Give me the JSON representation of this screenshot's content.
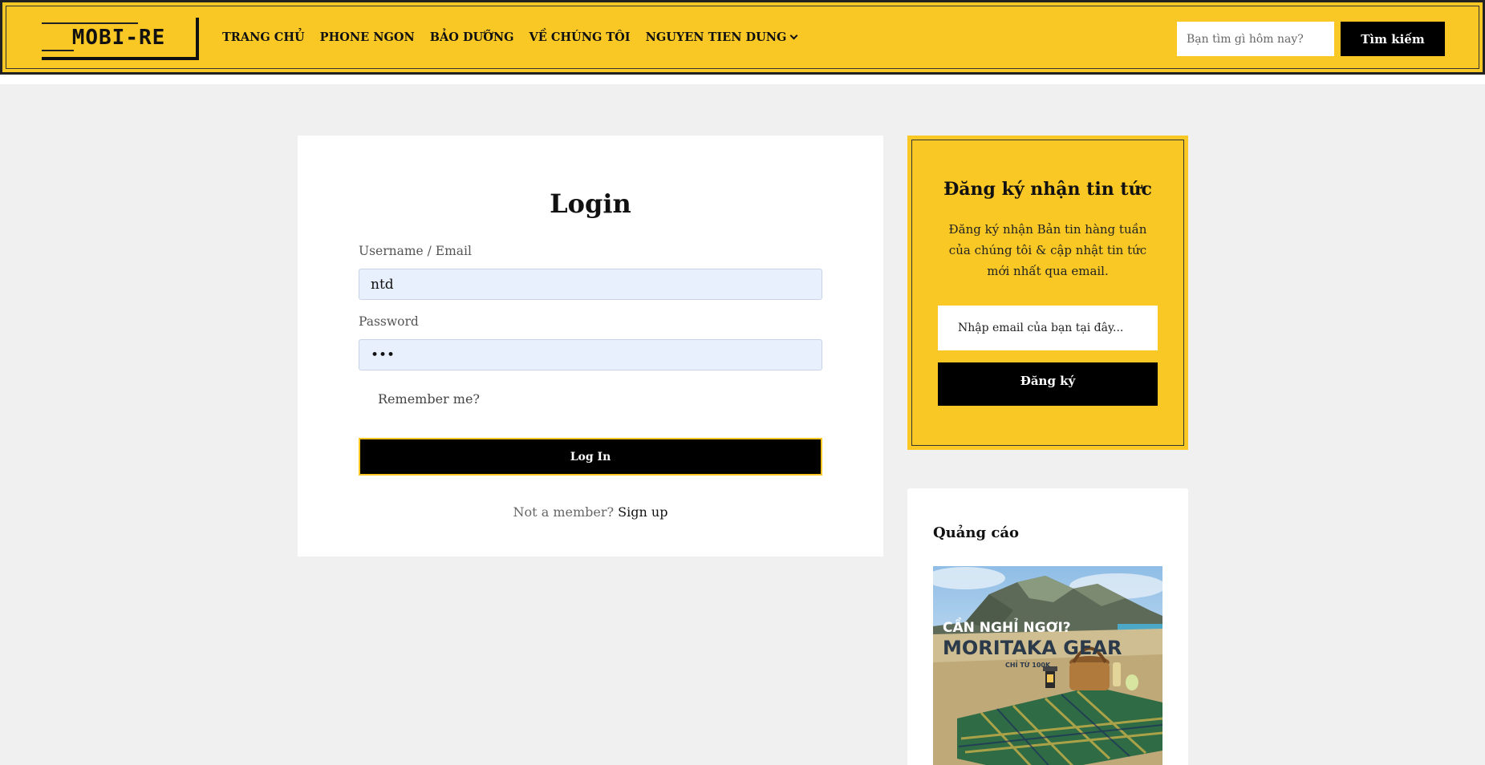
{
  "header": {
    "logo_text": "MOBI-RE",
    "nav": [
      {
        "label": "TRANG CHỦ"
      },
      {
        "label": "PHONE NGON"
      },
      {
        "label": "BẢO DƯỠNG"
      },
      {
        "label": "VỀ CHÚNG TÔI"
      },
      {
        "label": "NGUYEN TIEN DUNG",
        "has_dropdown": true
      }
    ],
    "search": {
      "placeholder": "Bạn tìm gì hôm nay?",
      "button_label": "Tìm kiếm"
    }
  },
  "login": {
    "title": "Login",
    "username_label": "Username / Email",
    "username_value": "ntd",
    "password_label": "Password",
    "password_value": "•••",
    "remember_label": "Remember me?",
    "submit_label": "Log In",
    "signup_prefix": "Not a member?",
    "signup_link": "Sign up"
  },
  "newsletter": {
    "title": "Đăng ký nhận tin tức",
    "description": "Đăng ký nhận Bản tin hàng tuần của chúng tôi & cập nhật tin tức mới nhất qua email.",
    "email_placeholder": "Nhập email của bạn tại đây...",
    "button_label": "Đăng ký"
  },
  "ad": {
    "title": "Quảng cáo",
    "image_headline": "CẦN NGHỈ NGƠI?",
    "image_brand": "MORITAKA GEAR",
    "image_sub": "CHỈ TỪ 100K"
  },
  "colors": {
    "accent": "#f9c825",
    "dark": "#000000",
    "page_bg": "#f0f0f0",
    "input_bg": "#e8f0fd"
  }
}
